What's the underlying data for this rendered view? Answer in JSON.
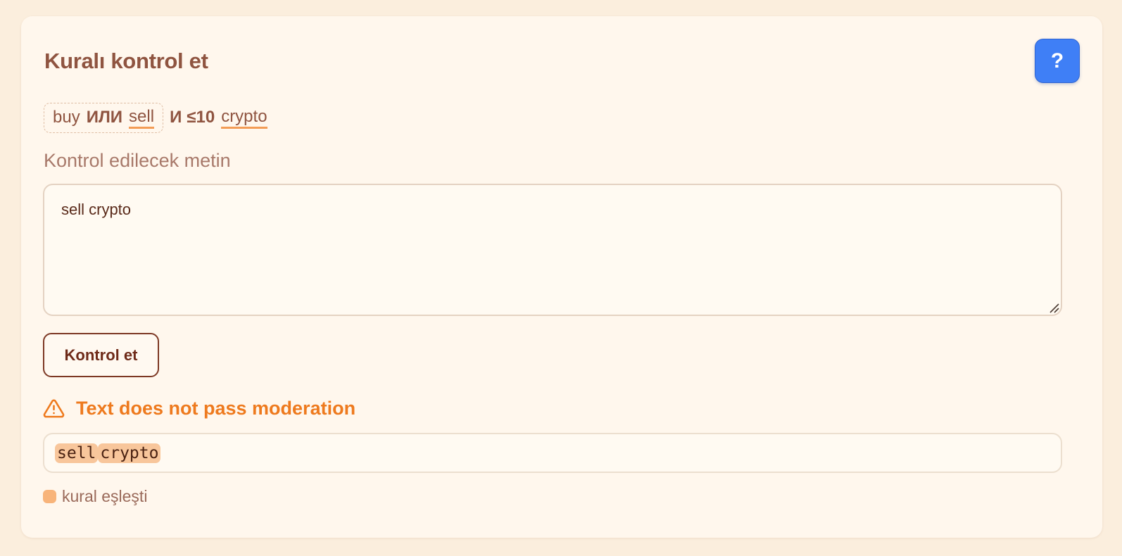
{
  "title": "Kuralı kontrol et",
  "help_button": {
    "label": "?",
    "icon": "question-mark-icon",
    "color": "#3f7ff6"
  },
  "rule": {
    "group": {
      "term1": "buy",
      "operator": "ИЛИ",
      "term2": "sell"
    },
    "operator": "И",
    "distance": "≤10",
    "term": "crypto"
  },
  "input": {
    "label": "Kontrol edilecek metin",
    "value": "sell crypto"
  },
  "check_button": {
    "label": "Kontrol et"
  },
  "result": {
    "icon": "warning-triangle-icon",
    "text": "Text does not pass moderation",
    "color": "#ee7a1e"
  },
  "preview": {
    "tokens": [
      "sell",
      "crypto"
    ]
  },
  "legend": {
    "label": "kural eşleşti",
    "color": "#f8b47a"
  }
}
